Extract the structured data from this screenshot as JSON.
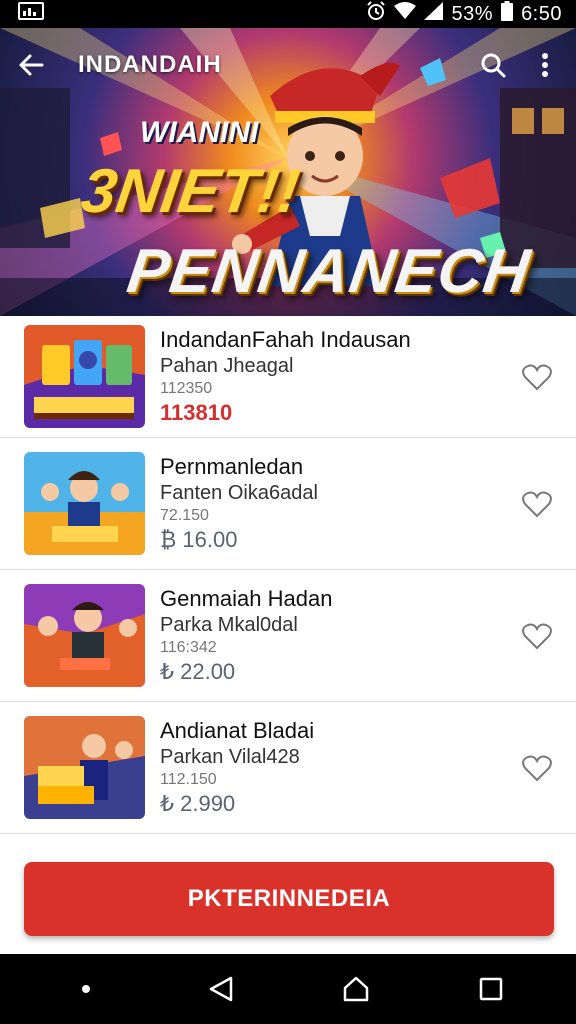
{
  "status_bar": {
    "battery_percent": "53%",
    "time": "6:50"
  },
  "app_bar": {
    "title": "INDANDAIH",
    "back_icon": "back-arrow-icon",
    "search_icon": "search-icon",
    "menu_icon": "more-vert-icon"
  },
  "hero": {
    "subtitle": "WIANINI",
    "big_text": "3NIET!!",
    "main_text": "PENNANECH"
  },
  "items": [
    {
      "title": "IndandanFahah Indausan",
      "subtitle": "Pahan Jheagal",
      "code": "112350",
      "price": "113810",
      "price_color": "#d32f2f"
    },
    {
      "title": "Pernmanledan",
      "subtitle": "Fanten Oika6adal",
      "code": "72.150",
      "price": "₿ 16.00"
    },
    {
      "title": "Genmaiah Hadan",
      "subtitle": "Parka Mkal0dal",
      "code": "116:342",
      "price": "₺ 22.00"
    },
    {
      "title": "Andianat Bladai",
      "subtitle": "Parkan Vilal428",
      "code": "112.150",
      "price": "₺ 2.990"
    }
  ],
  "cta": {
    "label": "PKTERINNEDEIA"
  },
  "colors": {
    "accent": "#d9322b",
    "price_red": "#d32f2f"
  }
}
